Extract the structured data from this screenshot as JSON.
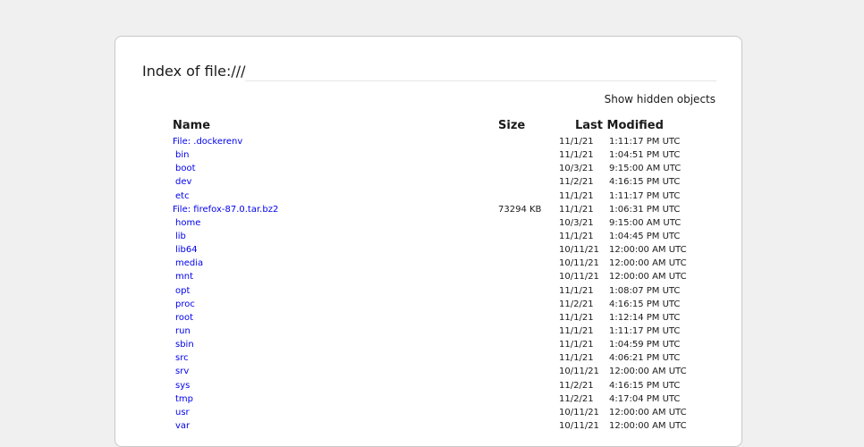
{
  "page": {
    "title": "Index of file:///",
    "hidden_toggle": "Show hidden objects"
  },
  "table": {
    "headers": {
      "name": "Name",
      "size": "Size",
      "modified": "Last Modified"
    },
    "rows": [
      {
        "name": "File: .dockerenv",
        "type": "file",
        "size": "",
        "date": "11/1/21",
        "time": "1:11:17 PM UTC"
      },
      {
        "name": "bin",
        "type": "dir",
        "size": "",
        "date": "11/1/21",
        "time": "1:04:51 PM UTC"
      },
      {
        "name": "boot",
        "type": "dir",
        "size": "",
        "date": "10/3/21",
        "time": "9:15:00 AM UTC"
      },
      {
        "name": "dev",
        "type": "dir",
        "size": "",
        "date": "11/2/21",
        "time": "4:16:15 PM UTC"
      },
      {
        "name": "etc",
        "type": "dir",
        "size": "",
        "date": "11/1/21",
        "time": "1:11:17 PM UTC"
      },
      {
        "name": "File: firefox-87.0.tar.bz2",
        "type": "file",
        "size": "73294 KB",
        "date": "11/1/21",
        "time": "1:06:31 PM UTC"
      },
      {
        "name": "home",
        "type": "dir",
        "size": "",
        "date": "10/3/21",
        "time": "9:15:00 AM UTC"
      },
      {
        "name": "lib",
        "type": "dir",
        "size": "",
        "date": "11/1/21",
        "time": "1:04:45 PM UTC"
      },
      {
        "name": "lib64",
        "type": "dir",
        "size": "",
        "date": "10/11/21",
        "time": "12:00:00 AM UTC"
      },
      {
        "name": "media",
        "type": "dir",
        "size": "",
        "date": "10/11/21",
        "time": "12:00:00 AM UTC"
      },
      {
        "name": "mnt",
        "type": "dir",
        "size": "",
        "date": "10/11/21",
        "time": "12:00:00 AM UTC"
      },
      {
        "name": "opt",
        "type": "dir",
        "size": "",
        "date": "11/1/21",
        "time": "1:08:07 PM UTC"
      },
      {
        "name": "proc",
        "type": "dir",
        "size": "",
        "date": "11/2/21",
        "time": "4:16:15 PM UTC"
      },
      {
        "name": "root",
        "type": "dir",
        "size": "",
        "date": "11/1/21",
        "time": "1:12:14 PM UTC"
      },
      {
        "name": "run",
        "type": "dir",
        "size": "",
        "date": "11/1/21",
        "time": "1:11:17 PM UTC"
      },
      {
        "name": "sbin",
        "type": "dir",
        "size": "",
        "date": "11/1/21",
        "time": "1:04:59 PM UTC"
      },
      {
        "name": "src",
        "type": "dir",
        "size": "",
        "date": "11/1/21",
        "time": "4:06:21 PM UTC"
      },
      {
        "name": "srv",
        "type": "dir",
        "size": "",
        "date": "10/11/21",
        "time": "12:00:00 AM UTC"
      },
      {
        "name": "sys",
        "type": "dir",
        "size": "",
        "date": "11/2/21",
        "time": "4:16:15 PM UTC"
      },
      {
        "name": "tmp",
        "type": "dir",
        "size": "",
        "date": "11/2/21",
        "time": "4:17:04 PM UTC"
      },
      {
        "name": "usr",
        "type": "dir",
        "size": "",
        "date": "10/11/21",
        "time": "12:00:00 AM UTC"
      },
      {
        "name": "var",
        "type": "dir",
        "size": "",
        "date": "10/11/21",
        "time": "12:00:00 AM UTC"
      }
    ]
  }
}
